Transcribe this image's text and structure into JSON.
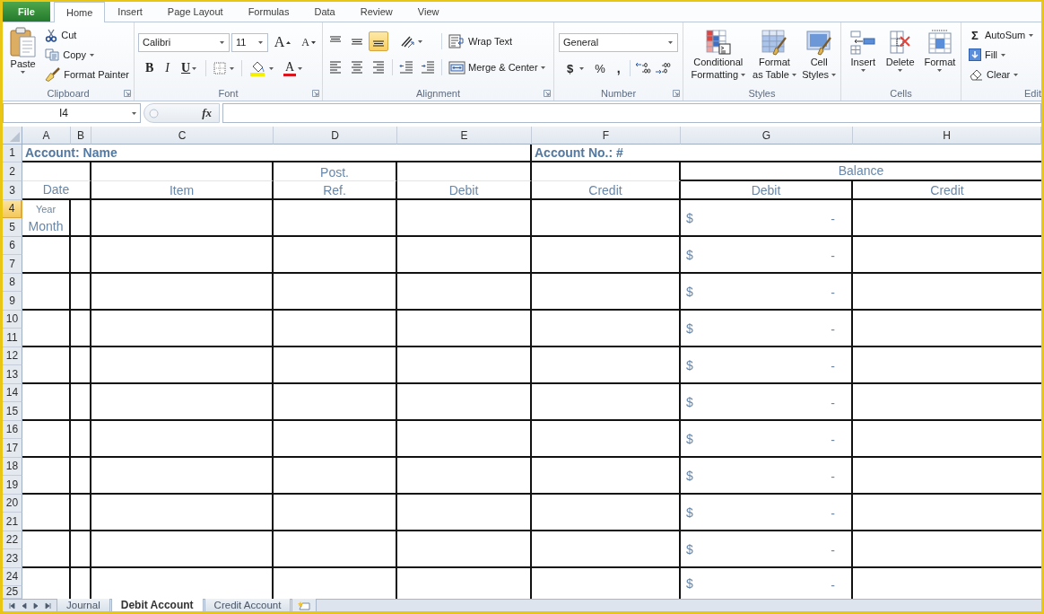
{
  "ribbon_tabs": [
    {
      "label": "File",
      "kind": "file",
      "selected": false
    },
    {
      "label": "Home",
      "kind": "tab",
      "selected": true
    },
    {
      "label": "Insert",
      "kind": "tab",
      "selected": false
    },
    {
      "label": "Page Layout",
      "kind": "tab",
      "selected": false
    },
    {
      "label": "Formulas",
      "kind": "tab",
      "selected": false
    },
    {
      "label": "Data",
      "kind": "tab",
      "selected": false
    },
    {
      "label": "Review",
      "kind": "tab",
      "selected": false
    },
    {
      "label": "View",
      "kind": "tab",
      "selected": false
    }
  ],
  "clipboard": {
    "paste": "Paste",
    "cut": "Cut",
    "copy": "Copy",
    "format_painter": "Format Painter",
    "label": "Clipboard"
  },
  "font": {
    "name": "Calibri",
    "size": "11",
    "grow": "A",
    "shrink": "A",
    "bold": "B",
    "italic": "I",
    "underline": "U",
    "font_color": "A",
    "label": "Font"
  },
  "alignment": {
    "vertical_align": [
      {
        "kind": "top",
        "on": false
      },
      {
        "kind": "middle",
        "on": false
      },
      {
        "kind": "bottom",
        "on": true
      }
    ],
    "horizontal_align": [
      {
        "kind": "left",
        "on": false
      },
      {
        "kind": "center",
        "on": false
      },
      {
        "kind": "right",
        "on": false
      }
    ],
    "wrap_text": "Wrap Text",
    "merge": "Merge & Center",
    "label": "Alignment"
  },
  "number": {
    "format": "General",
    "currency": "$",
    "percent": "%",
    "comma": ",",
    "label": "Number"
  },
  "styles": {
    "buttons": [
      {
        "kind": "conditional",
        "lines": [
          "Conditional",
          "Formatting"
        ]
      },
      {
        "kind": "table",
        "lines": [
          "Format",
          "as Table"
        ]
      },
      {
        "kind": "cell",
        "lines": [
          "Cell",
          "Styles"
        ]
      }
    ],
    "label": "Styles"
  },
  "cells": {
    "buttons": [
      {
        "kind": "insert",
        "label": "Insert"
      },
      {
        "kind": "delete",
        "label": "Delete"
      },
      {
        "kind": "format",
        "label": "Format"
      }
    ],
    "label": "Cells"
  },
  "editing": {
    "items": [
      {
        "kind": "autosum",
        "symbol": "Σ",
        "label": "AutoSum"
      },
      {
        "kind": "fill",
        "label": "Fill"
      },
      {
        "kind": "clear",
        "label": "Clear"
      }
    ],
    "label": "Edit"
  },
  "formula_bar": {
    "name_box": "I4",
    "function_label": "fx"
  },
  "sheet": {
    "columns": [
      "A",
      "B",
      "C",
      "D",
      "E",
      "F",
      "G",
      "H"
    ],
    "rows": [
      {
        "label": "1",
        "selected": false
      },
      {
        "label": "2",
        "selected": false
      },
      {
        "label": "3",
        "selected": false
      },
      {
        "label": "4",
        "selected": true
      },
      {
        "label": "5",
        "selected": false
      },
      {
        "label": "6",
        "selected": false
      },
      {
        "label": "7",
        "selected": false
      },
      {
        "label": "8",
        "selected": false
      },
      {
        "label": "9",
        "selected": false
      },
      {
        "label": "10",
        "selected": false
      },
      {
        "label": "11",
        "selected": false
      },
      {
        "label": "12",
        "selected": false
      },
      {
        "label": "13",
        "selected": false
      },
      {
        "label": "14",
        "selected": false
      },
      {
        "label": "15",
        "selected": false
      },
      {
        "label": "16",
        "selected": false
      },
      {
        "label": "17",
        "selected": false
      },
      {
        "label": "18",
        "selected": false
      },
      {
        "label": "19",
        "selected": false
      },
      {
        "label": "20",
        "selected": false
      },
      {
        "label": "21",
        "selected": false
      },
      {
        "label": "22",
        "selected": false
      },
      {
        "label": "23",
        "selected": false
      },
      {
        "label": "24",
        "selected": false
      },
      {
        "label": "25",
        "selected": false
      }
    ],
    "account_name": "Account: Name",
    "account_no": "Account No.: #",
    "headers": {
      "date": "Date",
      "item": "Item",
      "post": "Post.",
      "ref": "Ref.",
      "debit": "Debit",
      "credit": "Credit",
      "balance": "Balance",
      "balance_debit": "Debit",
      "balance_credit": "Credit"
    },
    "entries": [
      {
        "year": "Year",
        "month": "Month",
        "currency": "$",
        "amount": "-"
      },
      {
        "currency": "$",
        "amount": "-"
      },
      {
        "currency": "$",
        "amount": "-"
      },
      {
        "currency": "$",
        "amount": "-"
      },
      {
        "currency": "$",
        "amount": "-"
      },
      {
        "currency": "$",
        "amount": "-"
      },
      {
        "currency": "$",
        "amount": "-"
      },
      {
        "currency": "$",
        "amount": "-"
      },
      {
        "currency": "$",
        "amount": "-"
      },
      {
        "currency": "$",
        "amount": "-"
      },
      {
        "currency": "$",
        "amount": "-"
      }
    ]
  },
  "sheet_tabs": [
    {
      "label": "Journal",
      "selected": false
    },
    {
      "label": "Debit Account",
      "selected": true
    },
    {
      "label": "Credit Account",
      "selected": false
    }
  ]
}
